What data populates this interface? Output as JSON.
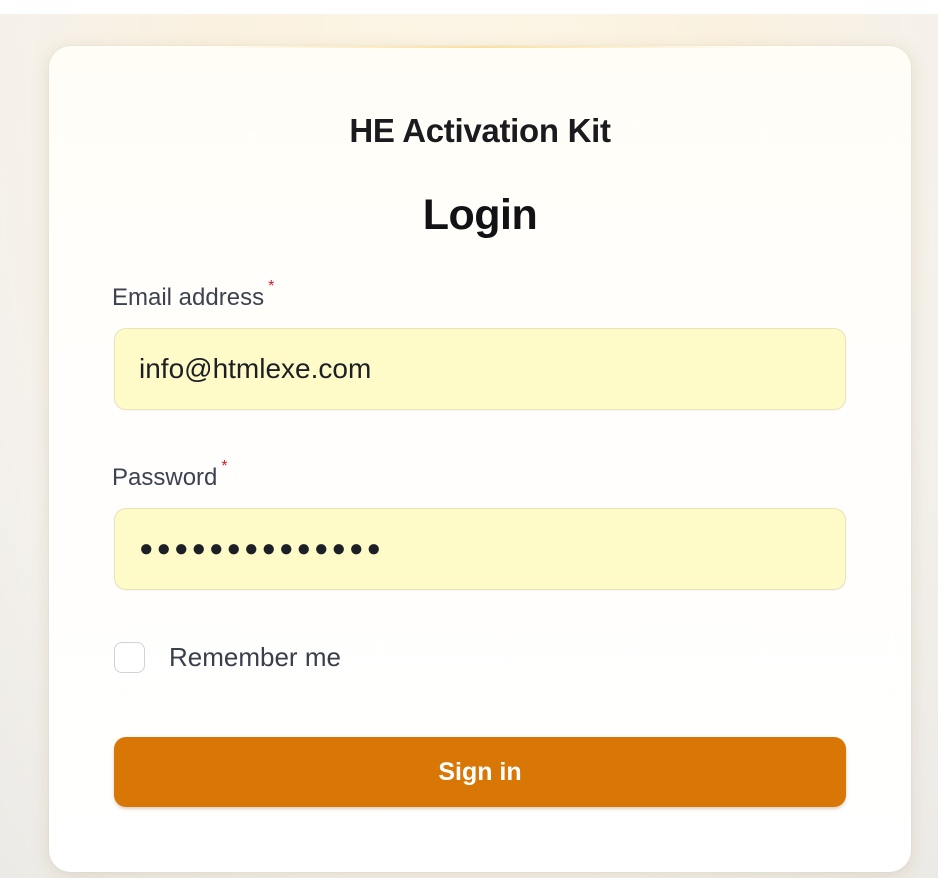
{
  "app": {
    "title": "HE Activation Kit"
  },
  "form": {
    "heading": "Login",
    "email": {
      "label": "Email address",
      "required_marker": "*",
      "value": "info@htmlexe.com"
    },
    "password": {
      "label": "Password",
      "required_marker": "*",
      "masked_value": "●●●●●●●●●●●●●●"
    },
    "remember": {
      "label": "Remember me",
      "checked": false
    },
    "submit_label": "Sign in"
  },
  "colors": {
    "accent": "#d97706",
    "input_fill": "#fefbc8",
    "required": "#d0202b"
  }
}
